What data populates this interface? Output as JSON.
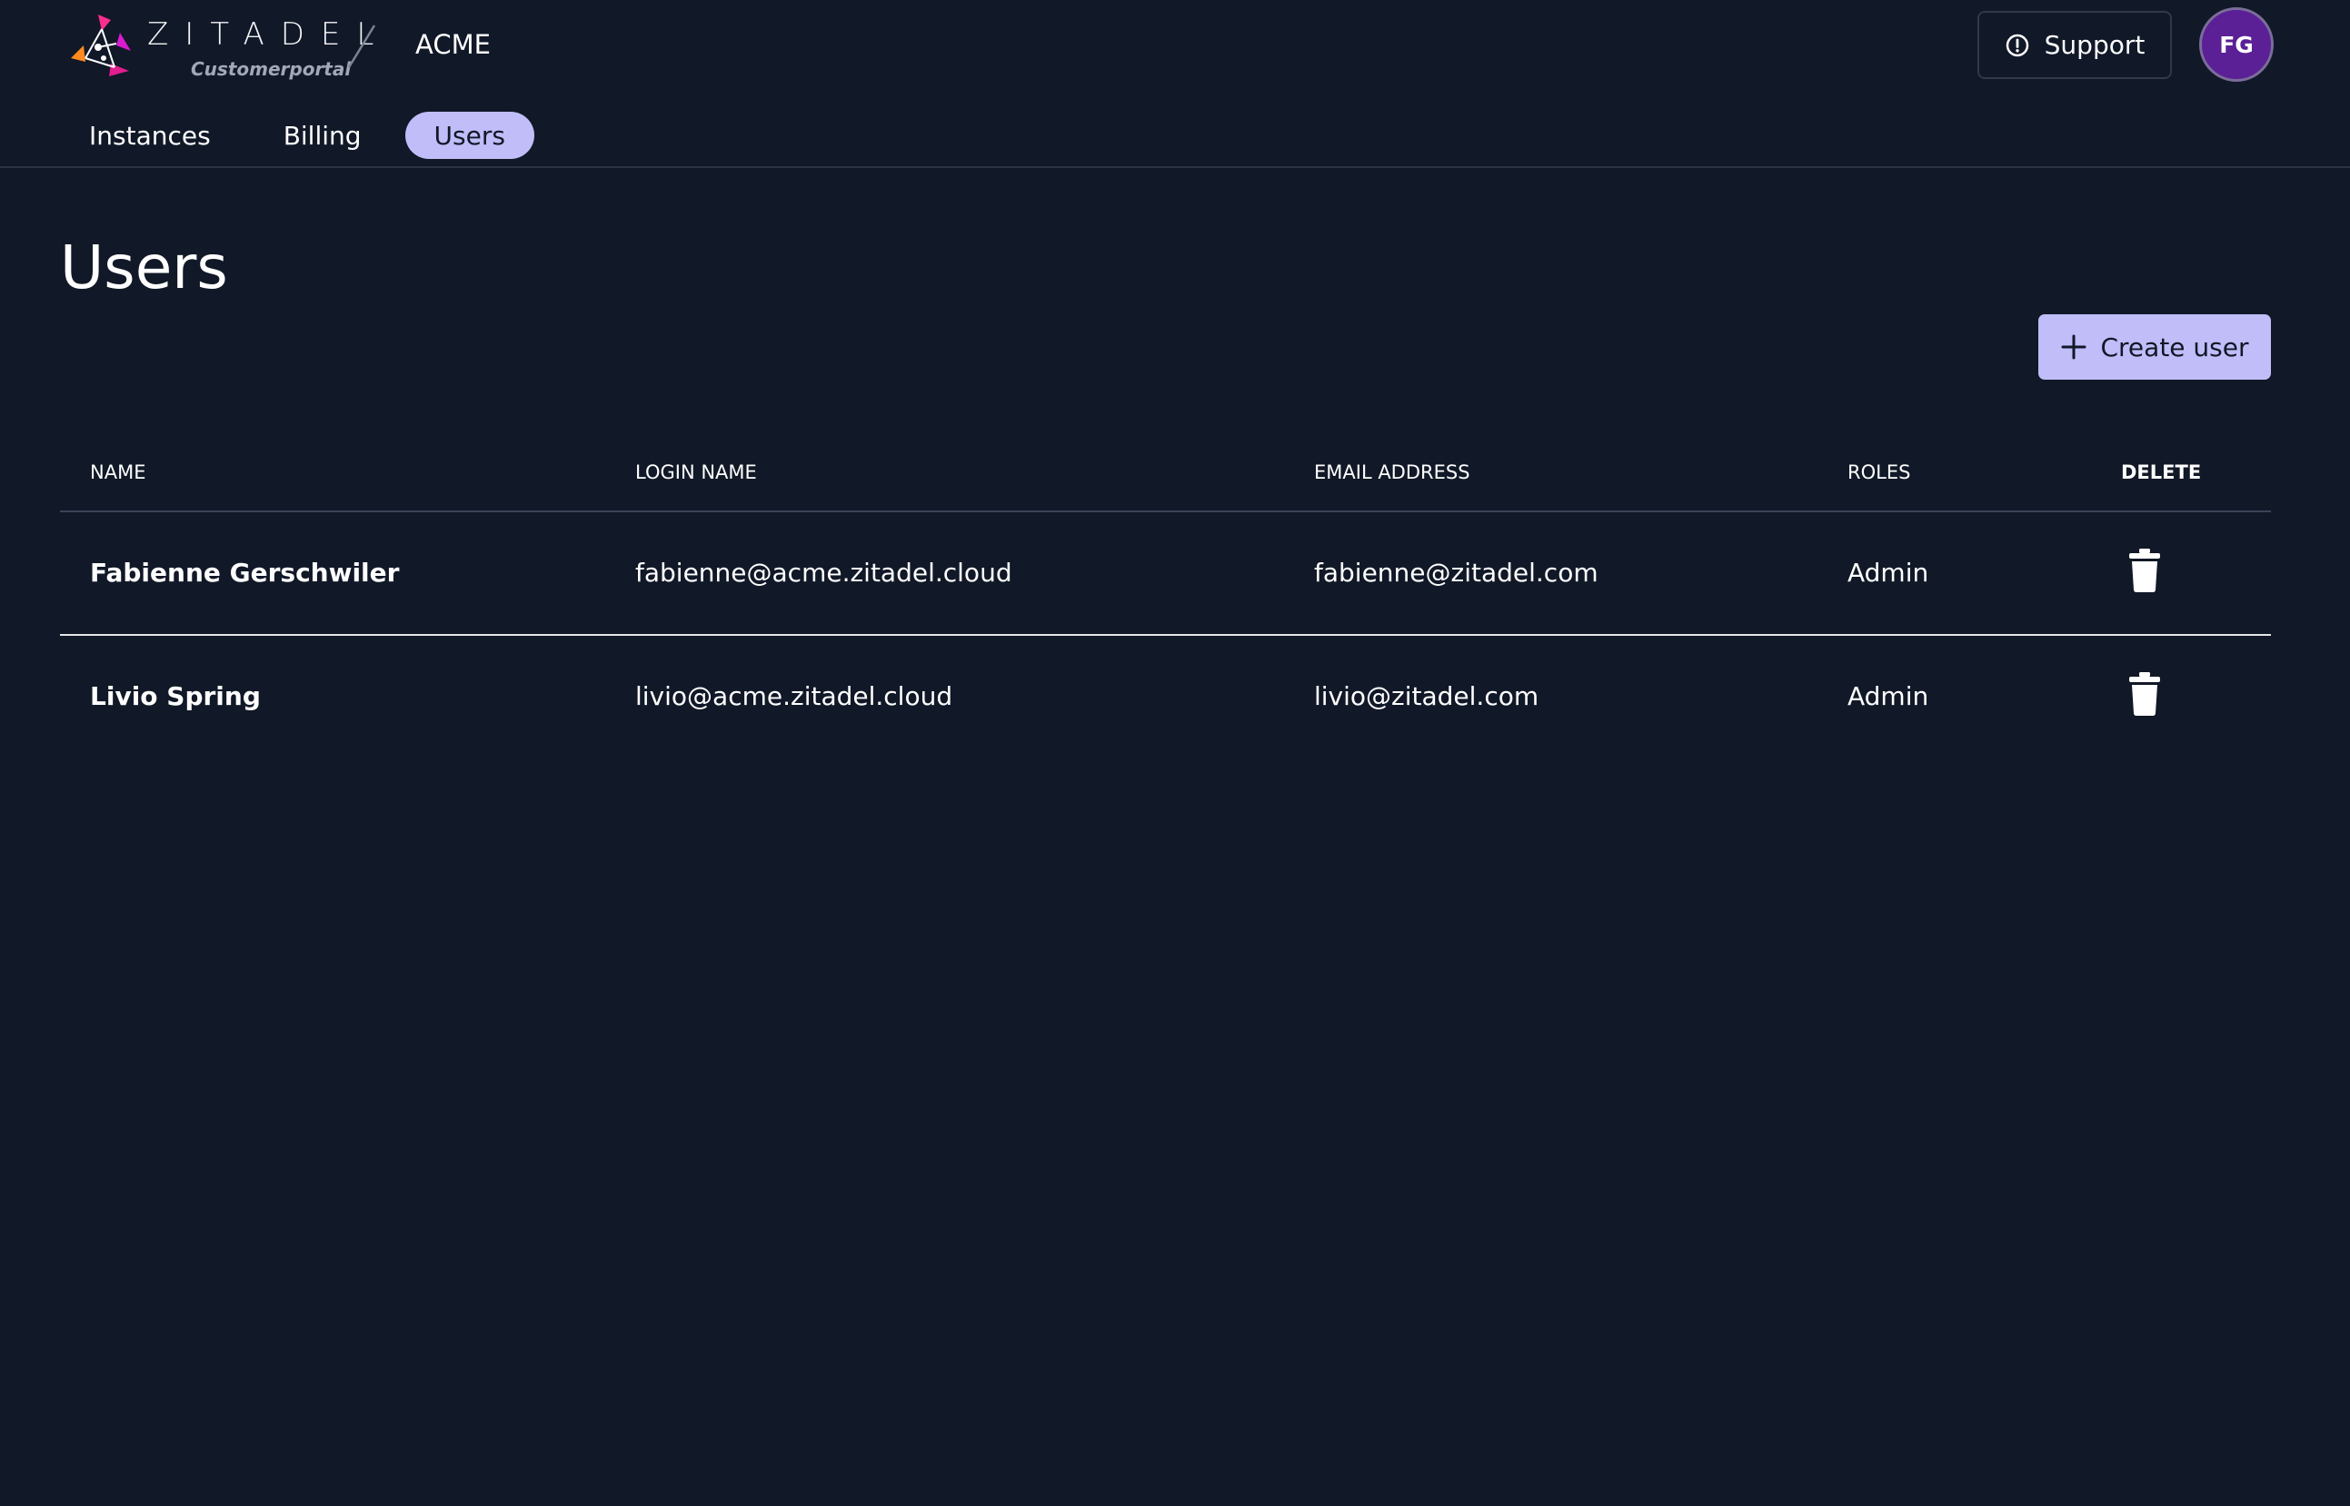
{
  "brand": {
    "wordmark": "ZITADEL",
    "subtitle": "Customerportal"
  },
  "header": {
    "org_name": "ACME",
    "support_label": "Support",
    "avatar_initials": "FG"
  },
  "nav": {
    "tabs": [
      {
        "label": "Instances",
        "active": false
      },
      {
        "label": "Billing",
        "active": false
      },
      {
        "label": "Users",
        "active": true
      }
    ]
  },
  "page": {
    "title": "Users",
    "create_label": "Create user"
  },
  "table": {
    "columns": [
      "NAME",
      "LOGIN NAME",
      "EMAIL ADDRESS",
      "ROLES",
      "DELETE"
    ],
    "rows": [
      {
        "name": "Fabienne Gerschwiler",
        "login": "fabienne@acme.zitadel.cloud",
        "email": "fabienne@zitadel.com",
        "roles": "Admin"
      },
      {
        "name": "Livio Spring",
        "login": "livio@acme.zitadel.cloud",
        "email": "livio@zitadel.com",
        "roles": "Admin"
      }
    ]
  },
  "icons": {
    "logo": "zitadel-logo-icon",
    "support": "alert-circle-icon",
    "create": "plus-icon",
    "delete": "trash-icon"
  },
  "colors": {
    "background": "#111827",
    "accent": "#c0bdf9",
    "avatar": "#5b1f96",
    "logo_pink": "#ff2d8d",
    "logo_orange": "#ff8a1f"
  }
}
